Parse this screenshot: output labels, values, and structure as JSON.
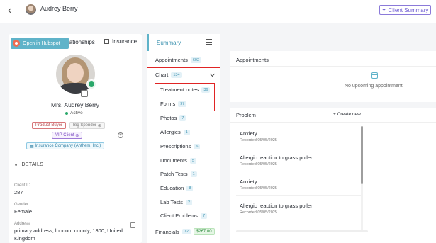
{
  "header": {
    "back_icon": "chevron-left-icon",
    "patient_name": "Audrey Berry",
    "client_summary_label": "Client Summary"
  },
  "profile": {
    "hubspot_label": "Open in Hubspot",
    "tabs": [
      "lationships",
      "Insurance"
    ],
    "name": "Mrs. Audrey Berry",
    "status": "Active",
    "tags": [
      "Product Buyer",
      "Big Spender",
      "VIP Client",
      "Insurance Company (Anthem, Inc.)"
    ],
    "details_label": "DETAILS",
    "fields": [
      {
        "label": "Client ID",
        "value": "287"
      },
      {
        "label": "Gender",
        "value": "Female"
      },
      {
        "label": "Address",
        "value_line1": "primary address, london, county, 1300, United",
        "value_line2": "Kingdom"
      }
    ]
  },
  "nav": {
    "summary": "Summary",
    "items": [
      {
        "label": "Appointments",
        "count": "602"
      },
      {
        "label": "Chart",
        "count": "134"
      },
      {
        "label": "Treatment notes",
        "count": "36"
      },
      {
        "label": "Forms",
        "count": "97"
      },
      {
        "label": "Photos",
        "count": "7"
      },
      {
        "label": "Allergies",
        "count": "1"
      },
      {
        "label": "Prescriptions",
        "count": "6"
      },
      {
        "label": "Documents",
        "count": "5"
      },
      {
        "label": "Patch Tests",
        "count": "1"
      },
      {
        "label": "Education",
        "count": "8"
      },
      {
        "label": "Lab Tests",
        "count": "2"
      },
      {
        "label": "Client Problems",
        "count": "7"
      },
      {
        "label": "Financials",
        "count": "72",
        "amount": "$267.00"
      }
    ]
  },
  "appointments": {
    "title": "Appointments",
    "empty_text": "No upcoming appointment"
  },
  "problems": {
    "title": "Problem",
    "create_label": "+ Create new",
    "items": [
      {
        "title": "Anxiety",
        "date": "Recorded 05/05/2025"
      },
      {
        "title": "Allergic reaction to grass pollen",
        "date": "Recorded 05/05/2025"
      },
      {
        "title": "Anxiety",
        "date": "Recorded 05/05/2025"
      },
      {
        "title": "Allergic reaction to grass pollen",
        "date": "Recorded 05/05/2025"
      }
    ]
  },
  "colors": {
    "accent": "#5fb3c9",
    "highlight_box": "#e02424",
    "active_status": "#2aa86a"
  }
}
